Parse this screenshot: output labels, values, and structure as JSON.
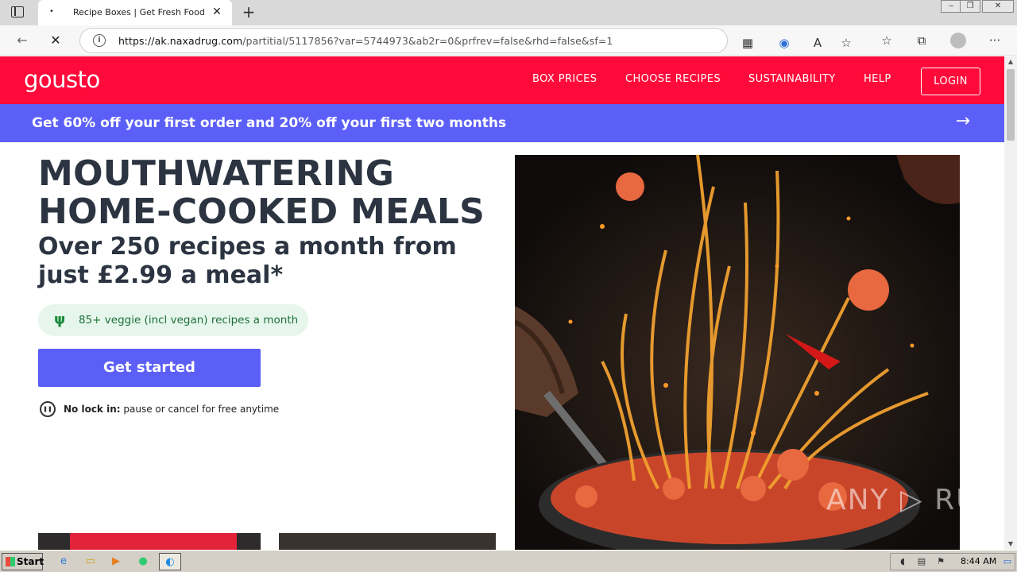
{
  "browser": {
    "tab_title": "Recipe Boxes | Get Fresh Food &",
    "tab_favicon": "•",
    "new_tab_label": "+",
    "url_host": "https://ak.naxadrug.com",
    "url_path": "/partitial/5117856?var=5744973&ab2r=0&prfrev=false&rhd=false&sf=1",
    "toolbar_icons": [
      "apps-icon",
      "extension-icon",
      "read-aloud-icon",
      "add-favorite-icon",
      "favorites-icon",
      "collections-icon",
      "profile-icon",
      "more-icon"
    ]
  },
  "site": {
    "logo": "gousto",
    "nav": [
      "BOX PRICES",
      "CHOOSE RECIPES",
      "SUSTAINABILITY",
      "HELP"
    ],
    "login": "LOGIN",
    "promo": "Get 60% off your first order and 20% off your first two months",
    "hero_title_line1": "MOUTHWATERING",
    "hero_title_line2": "HOME-COOKED MEALS",
    "hero_sub": "Over 250 recipes a month from just £2.99 a meal*",
    "veggie_badge": "85+ veggie (incl vegan) recipes a month",
    "cta": "Get started",
    "nolock_bold": "No lock in:",
    "nolock_text": " pause or cancel for free anytime",
    "watermark": "ANY ▷ RUN"
  },
  "taskbar": {
    "start": "Start",
    "clock": "8:44 AM"
  },
  "colors": {
    "brand_red": "#ff0a3a",
    "promo_purple": "#5c5ff7",
    "veggie_green": "#e6f6ec",
    "text_dark": "#2b3440"
  }
}
